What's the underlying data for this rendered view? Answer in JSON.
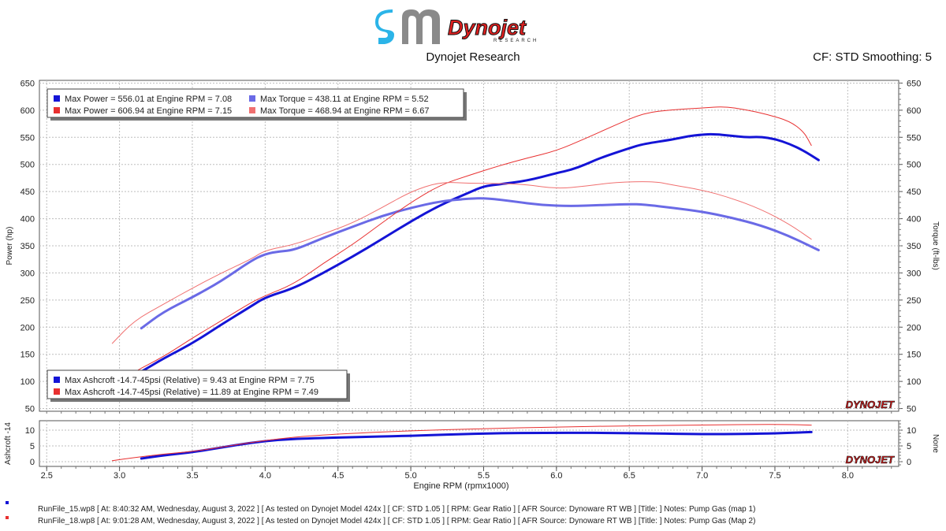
{
  "header": {
    "brand_name": "Dynojet",
    "brand_sub": "RESEARCH",
    "title": "Dynojet Research",
    "cf_smoothing": "CF: STD Smoothing: 5"
  },
  "watermark": "DYNOJET",
  "colors": {
    "run1_main": "#1414d6",
    "run1_light": "#6a6ae6",
    "run2_main": "#e83030",
    "run2_light": "#f07070",
    "grid": "#bdbdbd"
  },
  "legend_top": [
    {
      "text": "Max Power = 556.01 at Engine RPM = 7.08",
      "color": "#1414d6"
    },
    {
      "text": "Max Torque = 438.11 at Engine RPM = 5.52",
      "color": "#6a6ae6"
    },
    {
      "text": "Max Power = 606.94 at Engine RPM = 7.15",
      "color": "#e83030"
    },
    {
      "text": "Max Torque = 468.94 at Engine RPM = 6.67",
      "color": "#f07070"
    }
  ],
  "legend_bottom": [
    {
      "text": "Max Ashcroft -14.7-45psi (Relative) = 9.43 at Engine RPM = 7.75",
      "color": "#1414d6"
    },
    {
      "text": "Max Ashcroft -14.7-45psi (Relative) = 11.89 at Engine RPM = 7.49",
      "color": "#e83030"
    }
  ],
  "footer": [
    {
      "text": "RunFile_15.wp8 [ At: 8:40:32 AM, Wednesday, August 3, 2022 ] [ As tested on Dynojet Model 424x ] [ CF: STD 1.05 ] [ RPM: Gear Ratio ] [ AFR Source: Dynoware RT WB ] [Title: ]  Notes: Pump Gas (map 1)",
      "color": "#1414d6"
    },
    {
      "text": "RunFile_18.wp8 [ At: 9:01:28 AM, Wednesday, August 3, 2022 ] [ As tested on Dynojet Model 424x ] [ CF: STD 1.05 ] [ RPM: Gear Ratio ] [ AFR Source: Dynoware RT WB ] [Title: ]  Notes: Pump Gas (Map 2)",
      "color": "#e83030"
    }
  ],
  "chart_data": [
    {
      "type": "line",
      "xlabel": "",
      "ylabel": "Power (hp)",
      "ylabel_right": "Torque (ft-lbs)",
      "xlim": [
        2.45,
        8.35
      ],
      "ylim": [
        45,
        655
      ],
      "grid": true,
      "y_ticks": [
        50,
        100,
        150,
        200,
        250,
        300,
        350,
        400,
        450,
        500,
        550,
        600,
        650
      ],
      "legend_position": "top-left and bottom-left",
      "series": [
        {
          "name": "Max Power = 556.01 at Engine RPM = 7.08",
          "role": "run1-power",
          "color": "#1414d6",
          "width": 3,
          "x": [
            3.15,
            3.3,
            3.5,
            3.7,
            3.9,
            4.0,
            4.2,
            4.4,
            4.6,
            4.8,
            5.0,
            5.2,
            5.4,
            5.5,
            5.6,
            5.8,
            6.0,
            6.1,
            6.2,
            6.3,
            6.5,
            6.6,
            6.8,
            6.9,
            7.0,
            7.08,
            7.2,
            7.3,
            7.4,
            7.5,
            7.6,
            7.7,
            7.8
          ],
          "y": [
            118,
            142,
            170,
            205,
            238,
            255,
            272,
            300,
            330,
            362,
            395,
            425,
            448,
            460,
            463,
            470,
            484,
            490,
            500,
            512,
            530,
            538,
            546,
            552,
            555,
            556,
            553,
            550,
            551,
            547,
            538,
            525,
            508
          ]
        },
        {
          "name": "Max Torque = 438.11 at Engine RPM = 5.52",
          "role": "run1-torque",
          "color": "#6a6ae6",
          "width": 3,
          "x": [
            3.15,
            3.3,
            3.5,
            3.7,
            3.9,
            4.0,
            4.1,
            4.2,
            4.4,
            4.6,
            4.8,
            5.0,
            5.2,
            5.4,
            5.52,
            5.7,
            5.9,
            6.1,
            6.3,
            6.5,
            6.6,
            6.8,
            7.0,
            7.2,
            7.4,
            7.6,
            7.8
          ],
          "y": [
            198,
            228,
            255,
            285,
            322,
            335,
            340,
            342,
            365,
            385,
            405,
            420,
            432,
            437,
            438,
            432,
            425,
            423,
            425,
            427,
            426,
            420,
            413,
            402,
            388,
            368,
            342
          ]
        },
        {
          "name": "Max Power = 606.94 at Engine RPM = 7.15",
          "role": "run2-power",
          "color": "#e83030",
          "width": 1,
          "x": [
            2.95,
            3.1,
            3.3,
            3.5,
            3.7,
            3.9,
            4.0,
            4.2,
            4.4,
            4.6,
            4.8,
            5.0,
            5.2,
            5.4,
            5.6,
            5.8,
            6.0,
            6.2,
            6.4,
            6.6,
            6.8,
            7.0,
            7.15,
            7.3,
            7.45,
            7.6,
            7.7,
            7.75
          ],
          "y": [
            88,
            118,
            145,
            180,
            212,
            245,
            258,
            280,
            318,
            352,
            392,
            430,
            462,
            480,
            497,
            512,
            525,
            548,
            572,
            595,
            601,
            604,
            607,
            601,
            592,
            580,
            560,
            535
          ]
        },
        {
          "name": "Max Torque = 468.94 at Engine RPM = 6.67",
          "role": "run2-torque",
          "color": "#f07070",
          "width": 1,
          "x": [
            2.95,
            3.1,
            3.3,
            3.5,
            3.7,
            3.9,
            4.0,
            4.2,
            4.4,
            4.6,
            4.8,
            5.0,
            5.2,
            5.4,
            5.6,
            5.8,
            6.0,
            6.2,
            6.4,
            6.67,
            6.8,
            7.0,
            7.2,
            7.4,
            7.6,
            7.75
          ],
          "y": [
            170,
            212,
            242,
            272,
            300,
            325,
            342,
            352,
            372,
            392,
            420,
            450,
            468,
            465,
            465,
            463,
            455,
            460,
            467,
            469,
            462,
            453,
            438,
            418,
            390,
            362
          ]
        }
      ]
    },
    {
      "type": "line",
      "xlabel": "Engine RPM (rpmx1000)",
      "ylabel": "Ashcroft -14",
      "ylabel_right": "None",
      "xlim": [
        2.45,
        8.35
      ],
      "ylim": [
        -1.5,
        13
      ],
      "x_ticks": [
        2.5,
        3.0,
        3.5,
        4.0,
        4.5,
        5.0,
        5.5,
        6.0,
        6.5,
        7.0,
        7.5,
        8.0
      ],
      "x_tick_labels": [
        "2.5",
        "3.0",
        "3.5",
        "4.0",
        "4.5",
        "5.0",
        "5.5",
        "6.0",
        "6.5",
        "7.0",
        "7.5",
        "8.0"
      ],
      "y_ticks": [
        0,
        5,
        10
      ],
      "grid": true,
      "series": [
        {
          "name": "Max Ashcroft -14.7-45psi (Relative) = 9.43 at Engine RPM = 7.75",
          "role": "run1-boost",
          "color": "#1414d6",
          "width": 3,
          "x": [
            3.15,
            3.3,
            3.5,
            3.7,
            3.9,
            4.1,
            4.3,
            4.6,
            5.0,
            5.5,
            6.0,
            6.5,
            7.0,
            7.3,
            7.5,
            7.75
          ],
          "y": [
            1.0,
            2.0,
            3.0,
            4.5,
            6.0,
            7.0,
            7.4,
            7.8,
            8.2,
            9.0,
            9.2,
            9.1,
            8.7,
            8.8,
            9.0,
            9.4
          ]
        },
        {
          "name": "Max Ashcroft -14.7-45psi (Relative) = 11.89 at Engine RPM = 7.49",
          "role": "run2-boost",
          "color": "#e83030",
          "width": 1,
          "x": [
            2.95,
            3.1,
            3.3,
            3.5,
            3.7,
            3.9,
            4.1,
            4.3,
            4.6,
            5.0,
            5.5,
            6.0,
            6.5,
            7.0,
            7.49,
            7.75
          ],
          "y": [
            0.3,
            1.3,
            2.4,
            3.2,
            4.6,
            6.1,
            7.3,
            8.2,
            9.0,
            9.8,
            10.5,
            11.0,
            11.4,
            11.6,
            11.9,
            11.6
          ]
        }
      ]
    }
  ]
}
